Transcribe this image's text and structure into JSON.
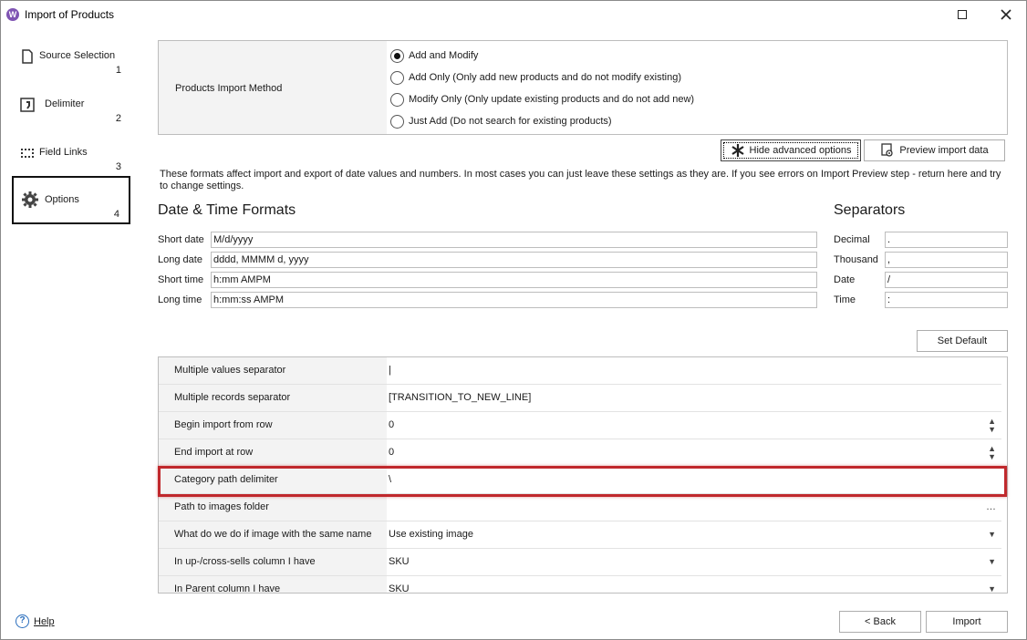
{
  "window": {
    "title": "Import of Products",
    "app_icon_letter": "W"
  },
  "sidebar": {
    "items": [
      {
        "label": "Source Selection",
        "num": "1",
        "icon": "document-icon"
      },
      {
        "label": "Delimiter",
        "num": "2",
        "icon": "delimiter-icon"
      },
      {
        "label": "Field Links",
        "num": "3",
        "icon": "field-links-icon"
      },
      {
        "label": "Options",
        "num": "4",
        "icon": "gear-icon",
        "active": true
      }
    ],
    "help_label": "Help"
  },
  "import_method": {
    "label": "Products Import Method",
    "options": [
      {
        "label": "Add and Modify",
        "selected": true
      },
      {
        "label": "Add Only (Only add new products and do not modify existing)",
        "selected": false
      },
      {
        "label": "Modify Only (Only update existing products and do not add new)",
        "selected": false
      },
      {
        "label": "Just Add (Do not search for existing products)",
        "selected": false
      }
    ]
  },
  "toolbar": {
    "hide_advanced": "Hide advanced options",
    "preview": "Preview import data",
    "set_default": "Set Default"
  },
  "info_text": "These formats affect import and export of date values and numbers. In most cases you can just leave these settings as they are. If you see errors on Import Preview step - return here and try to change settings.",
  "date_time": {
    "heading": "Date & Time Formats",
    "fields": [
      {
        "label": "Short date",
        "value": "M/d/yyyy"
      },
      {
        "label": "Long date",
        "value": "dddd, MMMM d, yyyy"
      },
      {
        "label": "Short time",
        "value": "h:mm AMPM"
      },
      {
        "label": "Long time",
        "value": "h:mm:ss AMPM"
      }
    ]
  },
  "separators": {
    "heading": "Separators",
    "fields": [
      {
        "label": "Decimal",
        "value": "."
      },
      {
        "label": "Thousand",
        "value": ","
      },
      {
        "label": "Date",
        "value": "/"
      },
      {
        "label": "Time",
        "value": ":"
      }
    ]
  },
  "options_grid": {
    "rows": [
      {
        "key": "Multiple values separator",
        "value": "|",
        "control": ""
      },
      {
        "key": "Multiple records separator",
        "value": "[TRANSITION_TO_NEW_LINE]",
        "control": ""
      },
      {
        "key": "Begin import from row",
        "value": "0",
        "control": "spinner"
      },
      {
        "key": "End import at row",
        "value": "0",
        "control": "spinner"
      },
      {
        "key": "Category path delimiter",
        "value": "\\",
        "control": ""
      },
      {
        "key": "Path to images folder",
        "value": "",
        "control": "ellipsis"
      },
      {
        "key": "What do we do if image with the same name",
        "value": "Use existing image",
        "control": "dropdown"
      },
      {
        "key": "In up-/cross-sells column I have",
        "value": "SKU",
        "control": "dropdown"
      },
      {
        "key": "In Parent column I have",
        "value": "SKU",
        "control": "dropdown"
      }
    ]
  },
  "footer": {
    "back": "< Back",
    "import": "Import"
  },
  "colors": {
    "highlight": "#c0282c",
    "panel_bg": "#f3f3f3",
    "border": "#bdbdbd"
  }
}
